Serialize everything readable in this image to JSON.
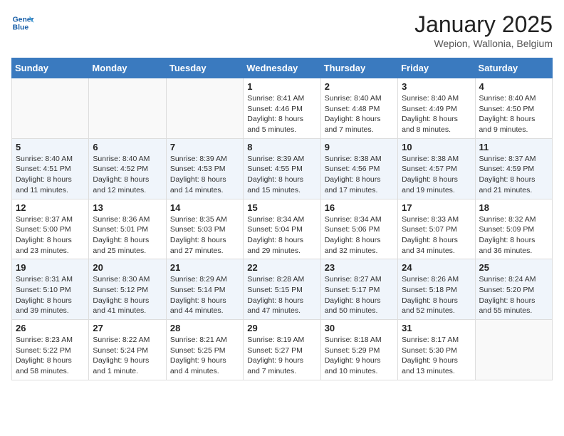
{
  "header": {
    "logo_line1": "General",
    "logo_line2": "Blue",
    "month_title": "January 2025",
    "location": "Wepion, Wallonia, Belgium"
  },
  "weekdays": [
    "Sunday",
    "Monday",
    "Tuesday",
    "Wednesday",
    "Thursday",
    "Friday",
    "Saturday"
  ],
  "weeks": [
    [
      {
        "day": "",
        "info": ""
      },
      {
        "day": "",
        "info": ""
      },
      {
        "day": "",
        "info": ""
      },
      {
        "day": "1",
        "info": "Sunrise: 8:41 AM\nSunset: 4:46 PM\nDaylight: 8 hours\nand 5 minutes."
      },
      {
        "day": "2",
        "info": "Sunrise: 8:40 AM\nSunset: 4:48 PM\nDaylight: 8 hours\nand 7 minutes."
      },
      {
        "day": "3",
        "info": "Sunrise: 8:40 AM\nSunset: 4:49 PM\nDaylight: 8 hours\nand 8 minutes."
      },
      {
        "day": "4",
        "info": "Sunrise: 8:40 AM\nSunset: 4:50 PM\nDaylight: 8 hours\nand 9 minutes."
      }
    ],
    [
      {
        "day": "5",
        "info": "Sunrise: 8:40 AM\nSunset: 4:51 PM\nDaylight: 8 hours\nand 11 minutes."
      },
      {
        "day": "6",
        "info": "Sunrise: 8:40 AM\nSunset: 4:52 PM\nDaylight: 8 hours\nand 12 minutes."
      },
      {
        "day": "7",
        "info": "Sunrise: 8:39 AM\nSunset: 4:53 PM\nDaylight: 8 hours\nand 14 minutes."
      },
      {
        "day": "8",
        "info": "Sunrise: 8:39 AM\nSunset: 4:55 PM\nDaylight: 8 hours\nand 15 minutes."
      },
      {
        "day": "9",
        "info": "Sunrise: 8:38 AM\nSunset: 4:56 PM\nDaylight: 8 hours\nand 17 minutes."
      },
      {
        "day": "10",
        "info": "Sunrise: 8:38 AM\nSunset: 4:57 PM\nDaylight: 8 hours\nand 19 minutes."
      },
      {
        "day": "11",
        "info": "Sunrise: 8:37 AM\nSunset: 4:59 PM\nDaylight: 8 hours\nand 21 minutes."
      }
    ],
    [
      {
        "day": "12",
        "info": "Sunrise: 8:37 AM\nSunset: 5:00 PM\nDaylight: 8 hours\nand 23 minutes."
      },
      {
        "day": "13",
        "info": "Sunrise: 8:36 AM\nSunset: 5:01 PM\nDaylight: 8 hours\nand 25 minutes."
      },
      {
        "day": "14",
        "info": "Sunrise: 8:35 AM\nSunset: 5:03 PM\nDaylight: 8 hours\nand 27 minutes."
      },
      {
        "day": "15",
        "info": "Sunrise: 8:34 AM\nSunset: 5:04 PM\nDaylight: 8 hours\nand 29 minutes."
      },
      {
        "day": "16",
        "info": "Sunrise: 8:34 AM\nSunset: 5:06 PM\nDaylight: 8 hours\nand 32 minutes."
      },
      {
        "day": "17",
        "info": "Sunrise: 8:33 AM\nSunset: 5:07 PM\nDaylight: 8 hours\nand 34 minutes."
      },
      {
        "day": "18",
        "info": "Sunrise: 8:32 AM\nSunset: 5:09 PM\nDaylight: 8 hours\nand 36 minutes."
      }
    ],
    [
      {
        "day": "19",
        "info": "Sunrise: 8:31 AM\nSunset: 5:10 PM\nDaylight: 8 hours\nand 39 minutes."
      },
      {
        "day": "20",
        "info": "Sunrise: 8:30 AM\nSunset: 5:12 PM\nDaylight: 8 hours\nand 41 minutes."
      },
      {
        "day": "21",
        "info": "Sunrise: 8:29 AM\nSunset: 5:14 PM\nDaylight: 8 hours\nand 44 minutes."
      },
      {
        "day": "22",
        "info": "Sunrise: 8:28 AM\nSunset: 5:15 PM\nDaylight: 8 hours\nand 47 minutes."
      },
      {
        "day": "23",
        "info": "Sunrise: 8:27 AM\nSunset: 5:17 PM\nDaylight: 8 hours\nand 50 minutes."
      },
      {
        "day": "24",
        "info": "Sunrise: 8:26 AM\nSunset: 5:18 PM\nDaylight: 8 hours\nand 52 minutes."
      },
      {
        "day": "25",
        "info": "Sunrise: 8:24 AM\nSunset: 5:20 PM\nDaylight: 8 hours\nand 55 minutes."
      }
    ],
    [
      {
        "day": "26",
        "info": "Sunrise: 8:23 AM\nSunset: 5:22 PM\nDaylight: 8 hours\nand 58 minutes."
      },
      {
        "day": "27",
        "info": "Sunrise: 8:22 AM\nSunset: 5:24 PM\nDaylight: 9 hours\nand 1 minute."
      },
      {
        "day": "28",
        "info": "Sunrise: 8:21 AM\nSunset: 5:25 PM\nDaylight: 9 hours\nand 4 minutes."
      },
      {
        "day": "29",
        "info": "Sunrise: 8:19 AM\nSunset: 5:27 PM\nDaylight: 9 hours\nand 7 minutes."
      },
      {
        "day": "30",
        "info": "Sunrise: 8:18 AM\nSunset: 5:29 PM\nDaylight: 9 hours\nand 10 minutes."
      },
      {
        "day": "31",
        "info": "Sunrise: 8:17 AM\nSunset: 5:30 PM\nDaylight: 9 hours\nand 13 minutes."
      },
      {
        "day": "",
        "info": ""
      }
    ]
  ]
}
